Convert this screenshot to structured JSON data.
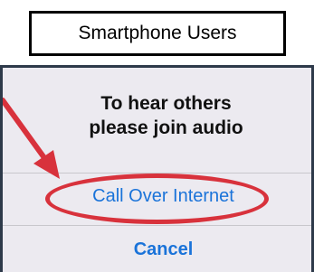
{
  "header": {
    "title": "Smartphone Users"
  },
  "dialog": {
    "message_line1": "To hear others",
    "message_line2": "please join audio",
    "primary_action": "Call Over Internet",
    "cancel_action": "Cancel"
  },
  "colors": {
    "action_blue": "#1a73d9",
    "annotation_red": "#d8323c",
    "dialog_background": "#eceaf0"
  },
  "annotations": {
    "arrow": "arrow-pointing-to-call-over-internet",
    "highlight": "red-oval-around-call-over-internet"
  }
}
